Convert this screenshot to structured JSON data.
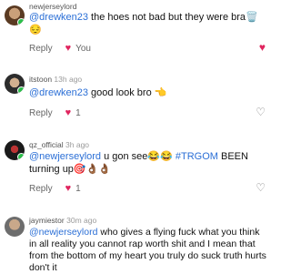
{
  "comments": [
    {
      "username": "newjerseylord",
      "time": "",
      "mention": "@drewken23",
      "text": " the hoes not bad but they were bra🗑️😔",
      "reply_label": "Reply",
      "like_label": "You",
      "liked": true
    },
    {
      "username": "itstoon",
      "time": "13h ago",
      "mention": "@drewken23",
      "text": " good look bro 👈",
      "reply_label": "Reply",
      "like_count": "1"
    },
    {
      "username": "qz_official",
      "time": "3h ago",
      "mention": "@newjerseylord",
      "text": " u gon see😂😂 ",
      "tag": "#TRGOM",
      "text2": " BEEN turning up🎯👌🏾👌🏾",
      "reply_label": "Reply",
      "like_count": "1"
    },
    {
      "username": "jaymiestor",
      "time": "30m ago",
      "mention": "@newjerseylord",
      "text": " who gives a flying fuck what you think in all reality you cannot rap worth shit and I mean that from the bottom of my heart you truly do suck truth hurts don't it"
    }
  ],
  "icons": {
    "heart_filled": "♥",
    "heart_outline": "♡"
  },
  "colors": {
    "like_red": "#e0245e",
    "mention_blue": "#2b6fd6",
    "online_green": "#2bbf4a"
  }
}
